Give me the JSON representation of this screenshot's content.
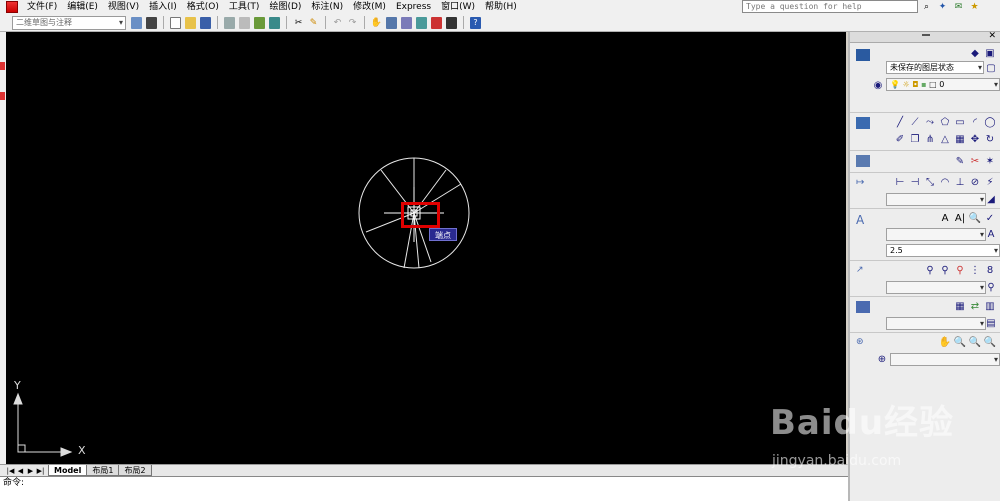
{
  "menubar": {
    "items": [
      "文件(F)",
      "编辑(E)",
      "视图(V)",
      "插入(I)",
      "格式(O)",
      "工具(T)",
      "绘图(D)",
      "标注(N)",
      "修改(M)",
      "Express",
      "窗口(W)",
      "帮助(H)"
    ],
    "help_placeholder": "Type a question for help"
  },
  "toolbar": {
    "workspace": "二维草图与注释"
  },
  "canvas": {
    "osnap_tooltip": "端点",
    "ucs_y": "Y",
    "ucs_x": "X"
  },
  "tabs": {
    "items": [
      "Model",
      "布局1",
      "布局2"
    ],
    "active": "Model"
  },
  "command": {
    "prompt": "命令:"
  },
  "panel": {
    "layer_state": "未保存的图层状态",
    "layer_current": "0",
    "text_height": "2.5"
  },
  "watermark": {
    "brand": "Baidu经验",
    "url": "jingyan.baidu.com"
  },
  "colors": {
    "canvas_bg": "#000000",
    "highlight": "#e00000",
    "tooltip_bg": "#2a2a90"
  }
}
